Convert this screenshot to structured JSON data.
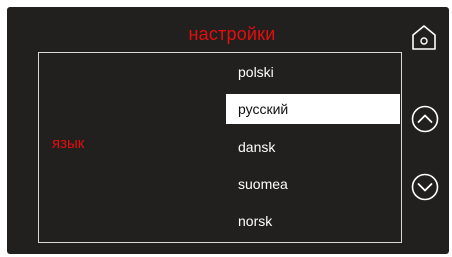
{
  "header": {
    "title": "настройки"
  },
  "setting": {
    "label": "язык"
  },
  "languages": [
    {
      "label": "polski"
    },
    {
      "label": "русский",
      "selected": true
    },
    {
      "label": "dansk"
    },
    {
      "label": "suomea"
    },
    {
      "label": "norsk"
    }
  ],
  "icons": {
    "home": "home-icon",
    "up": "chevron-up-icon",
    "down": "chevron-down-icon"
  },
  "colors": {
    "background": "#221f1f",
    "accent": "#e60d0d",
    "text": "#ffffff",
    "selected_bg": "#ffffff",
    "selected_text": "#111111",
    "border": "#d8d8d8"
  }
}
